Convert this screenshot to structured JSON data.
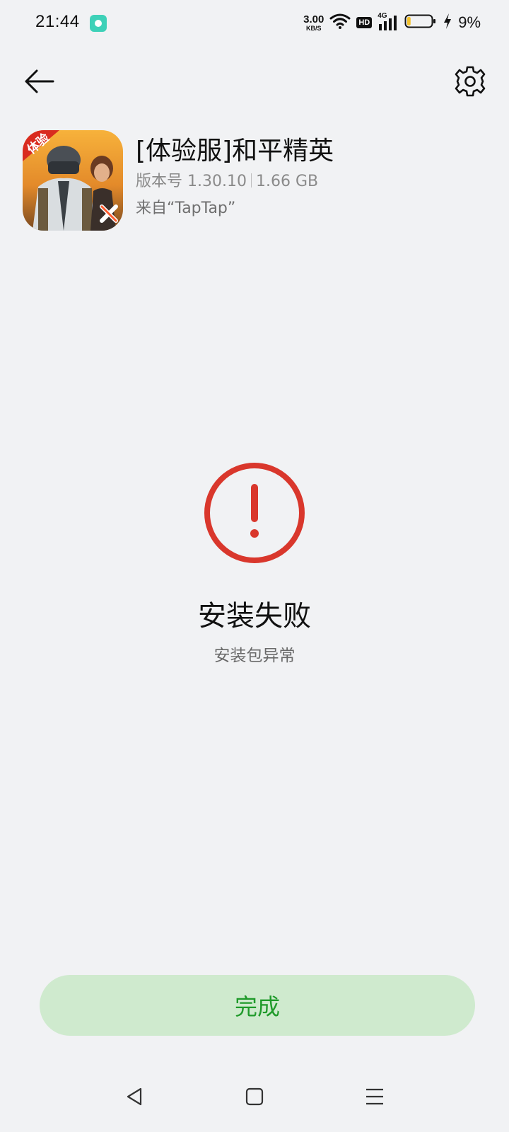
{
  "status_bar": {
    "time": "21:44",
    "net_speed_value": "3.00",
    "net_speed_unit": "KB/S",
    "hd_label": "HD",
    "network_type": "4G",
    "battery_percent": "9%",
    "battery_level": 0.09,
    "battery_color": "#f3c12b"
  },
  "app": {
    "name": "[体验服]和平精英",
    "version": "版本号 1.30.10",
    "size": "1.66 GB",
    "source": "来自“TapTap”",
    "icon_badge": "体验"
  },
  "result": {
    "title": "安装失败",
    "subtitle": "安装包异常",
    "icon": "alert-circle-icon",
    "color": "#d9372c"
  },
  "actions": {
    "done_label": "完成",
    "done_bg": "#cfeace",
    "done_text_color": "#1f9a2a"
  }
}
